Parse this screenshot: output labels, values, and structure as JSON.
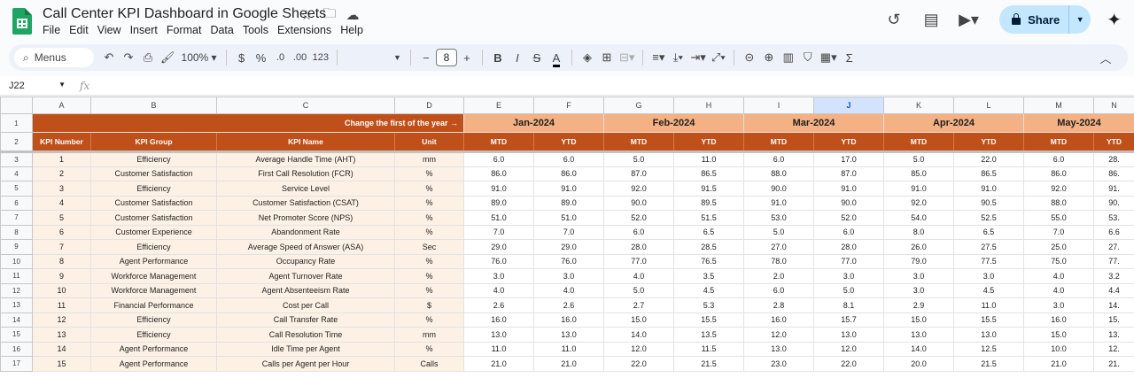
{
  "app": {
    "title": "Call Center KPI Dashboard in Google Sheets",
    "menus": [
      "File",
      "Edit",
      "View",
      "Insert",
      "Format",
      "Data",
      "Tools",
      "Extensions",
      "Help"
    ],
    "share_label": "Share"
  },
  "toolbar": {
    "search_label": "Menus",
    "zoom": "100%",
    "currency": "$",
    "percent": "%",
    "dec_decrease": ".0",
    "dec_increase": ".00",
    "number_format": "123",
    "font_size": "8",
    "minus": "−",
    "plus": "+",
    "bold": "B",
    "italic": "I",
    "strike": "S",
    "text_color": "A"
  },
  "formula_bar": {
    "cell_ref": "J22",
    "fx": "fx",
    "value": ""
  },
  "sheet": {
    "columns": [
      "A",
      "B",
      "C",
      "D",
      "E",
      "F",
      "G",
      "H",
      "I",
      "J",
      "K",
      "L",
      "M",
      "N"
    ],
    "selected_column": "J",
    "row1_note": "Change the first of the year →",
    "months": [
      "Jan-2024",
      "Feb-2024",
      "Mar-2024",
      "Apr-2024",
      "May-2024"
    ],
    "headers": [
      "KPI Number",
      "KPI Group",
      "KPI Name",
      "Unit"
    ],
    "sub_headers": [
      "MTD",
      "YTD",
      "MTD",
      "YTD",
      "MTD",
      "YTD",
      "MTD",
      "YTD",
      "MTD",
      "YTD"
    ],
    "rows": [
      {
        "n": "3",
        "cells": [
          "1",
          "Efficiency",
          "Average Handle Time (AHT)",
          "mm",
          "6.0",
          "6.0",
          "5.0",
          "11.0",
          "6.0",
          "17.0",
          "5.0",
          "22.0",
          "6.0",
          "28."
        ]
      },
      {
        "n": "4",
        "cells": [
          "2",
          "Customer Satisfaction",
          "First Call Resolution (FCR)",
          "%",
          "86.0",
          "86.0",
          "87.0",
          "86.5",
          "88.0",
          "87.0",
          "85.0",
          "86.5",
          "86.0",
          "86."
        ]
      },
      {
        "n": "5",
        "cells": [
          "3",
          "Efficiency",
          "Service Level",
          "%",
          "91.0",
          "91.0",
          "92.0",
          "91.5",
          "90.0",
          "91.0",
          "91.0",
          "91.0",
          "92.0",
          "91."
        ]
      },
      {
        "n": "6",
        "cells": [
          "4",
          "Customer Satisfaction",
          "Customer Satisfaction (CSAT)",
          "%",
          "89.0",
          "89.0",
          "90.0",
          "89.5",
          "91.0",
          "90.0",
          "92.0",
          "90.5",
          "88.0",
          "90."
        ]
      },
      {
        "n": "7",
        "cells": [
          "5",
          "Customer Satisfaction",
          "Net Promoter Score (NPS)",
          "%",
          "51.0",
          "51.0",
          "52.0",
          "51.5",
          "53.0",
          "52.0",
          "54.0",
          "52.5",
          "55.0",
          "53."
        ]
      },
      {
        "n": "8",
        "cells": [
          "6",
          "Customer Experience",
          "Abandonment Rate",
          "%",
          "7.0",
          "7.0",
          "6.0",
          "6.5",
          "5.0",
          "6.0",
          "8.0",
          "6.5",
          "7.0",
          "6.6"
        ]
      },
      {
        "n": "9",
        "cells": [
          "7",
          "Efficiency",
          "Average Speed of Answer (ASA)",
          "Sec",
          "29.0",
          "29.0",
          "28.0",
          "28.5",
          "27.0",
          "28.0",
          "26.0",
          "27.5",
          "25.0",
          "27."
        ]
      },
      {
        "n": "10",
        "cells": [
          "8",
          "Agent Performance",
          "Occupancy Rate",
          "%",
          "76.0",
          "76.0",
          "77.0",
          "76.5",
          "78.0",
          "77.0",
          "79.0",
          "77.5",
          "75.0",
          "77."
        ]
      },
      {
        "n": "11",
        "cells": [
          "9",
          "Workforce Management",
          "Agent Turnover Rate",
          "%",
          "3.0",
          "3.0",
          "4.0",
          "3.5",
          "2.0",
          "3.0",
          "3.0",
          "3.0",
          "4.0",
          "3.2"
        ]
      },
      {
        "n": "12",
        "cells": [
          "10",
          "Workforce Management",
          "Agent Absenteeism Rate",
          "%",
          "4.0",
          "4.0",
          "5.0",
          "4.5",
          "6.0",
          "5.0",
          "3.0",
          "4.5",
          "4.0",
          "4.4"
        ]
      },
      {
        "n": "13",
        "cells": [
          "11",
          "Financial Performance",
          "Cost per Call",
          "$",
          "2.6",
          "2.6",
          "2.7",
          "5.3",
          "2.8",
          "8.1",
          "2.9",
          "11.0",
          "3.0",
          "14."
        ]
      },
      {
        "n": "14",
        "cells": [
          "12",
          "Efficiency",
          "Call Transfer Rate",
          "%",
          "16.0",
          "16.0",
          "15.0",
          "15.5",
          "16.0",
          "15.7",
          "15.0",
          "15.5",
          "16.0",
          "15."
        ]
      },
      {
        "n": "15",
        "cells": [
          "13",
          "Efficiency",
          "Call Resolution Time",
          "mm",
          "13.0",
          "13.0",
          "14.0",
          "13.5",
          "12.0",
          "13.0",
          "13.0",
          "13.0",
          "15.0",
          "13."
        ]
      },
      {
        "n": "16",
        "cells": [
          "14",
          "Agent Performance",
          "Idle Time per Agent",
          "%",
          "11.0",
          "11.0",
          "12.0",
          "11.5",
          "13.0",
          "12.0",
          "14.0",
          "12.5",
          "10.0",
          "12."
        ]
      },
      {
        "n": "17",
        "cells": [
          "15",
          "Agent Performance",
          "Calls per Agent per Hour",
          "Calls",
          "21.0",
          "21.0",
          "22.0",
          "21.5",
          "23.0",
          "22.0",
          "20.0",
          "21.5",
          "21.0",
          "21."
        ]
      }
    ]
  },
  "colors": {
    "header_brown": "#c0501a",
    "month_peach": "#f4b183",
    "label_bg": "#fdf1e6",
    "share_bg": "#c2e7ff",
    "selected_col": "#d3e3fd"
  }
}
